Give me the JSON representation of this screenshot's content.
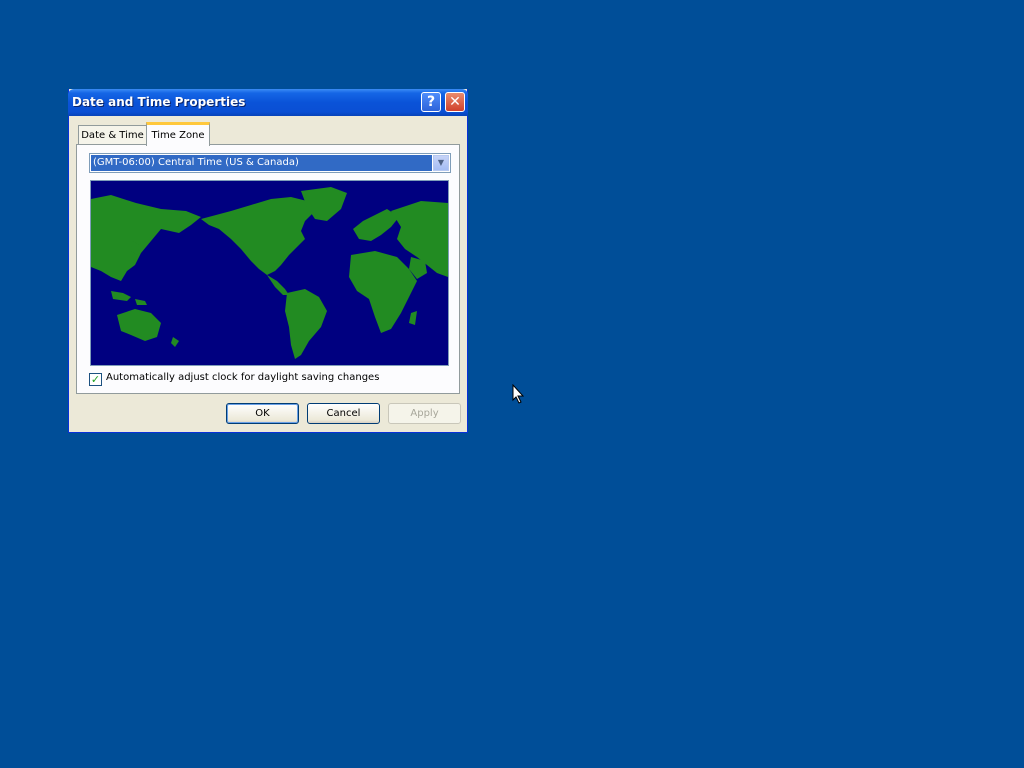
{
  "window": {
    "title": "Date and Time Properties",
    "help_label": "?",
    "close_label": "✕"
  },
  "tabs": [
    {
      "label": "Date & Time",
      "selected": false
    },
    {
      "label": "Time Zone",
      "selected": true
    }
  ],
  "timezone": {
    "selected": "(GMT-06:00) Central Time (US & Canada)",
    "dropdown_icon": "chevron-down-icon"
  },
  "map": {
    "ocean_color": "#000080",
    "land_color": "#228b22"
  },
  "daylight": {
    "checked": true,
    "label": "Automatically adjust clock for daylight saving changes"
  },
  "buttons": {
    "ok": "OK",
    "cancel": "Cancel",
    "apply": "Apply",
    "apply_enabled": false
  },
  "colors": {
    "desktop": "#004e98",
    "selection": "#316ac5"
  }
}
